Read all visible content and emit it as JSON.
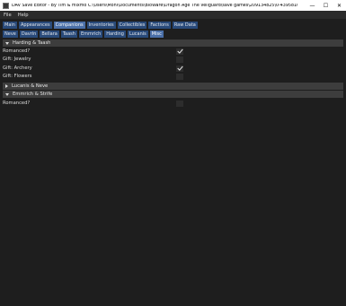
{
  "window": {
    "title": "DAV Save Editor - By Tim & mixmo C:\\Users\\Moni\\Documents\\BioWare\\Dragon Age The Veilguard\\save games\\209134825\\0-4395810-4395810 Saria-fro...",
    "minimize_glyph": "—",
    "maximize_glyph": "☐",
    "close_glyph": "✕"
  },
  "menu": {
    "items": [
      "File",
      "Help"
    ]
  },
  "tabs_main": [
    "Main",
    "Appearances",
    "Companions",
    "Inventories",
    "Collectibles",
    "Factions",
    "Raw Data"
  ],
  "tabs_main_active": "Companions",
  "tabs_companions": [
    "Neve",
    "Davrin",
    "Bellara",
    "Taash",
    "Emmrich",
    "Harding",
    "Lucanis",
    "Misc"
  ],
  "tabs_companions_active": "Misc",
  "sections": [
    {
      "title": "Harding & Taash",
      "expanded": true,
      "rows": [
        {
          "label": "Romanced?",
          "checked": true
        },
        {
          "label": "Gift: Jewelry",
          "checked": false
        },
        {
          "label": "Gift: Archery",
          "checked": true
        },
        {
          "label": "Gift: Flowers",
          "checked": false
        }
      ]
    },
    {
      "title": "Lucanis & Neve",
      "expanded": false
    },
    {
      "title": "Emmrich & Strife",
      "expanded": true,
      "rows": [
        {
          "label": "Romanced?",
          "checked": false
        }
      ]
    }
  ],
  "colors": {
    "tab": "#294a7a",
    "tab_active": "#4a6fa8",
    "header": "#3d3d3d",
    "background": "#1e1e1e"
  }
}
